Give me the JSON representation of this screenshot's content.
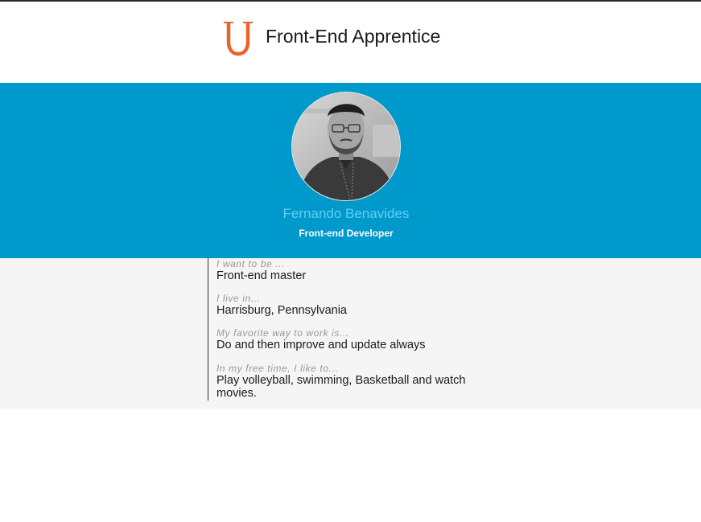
{
  "header": {
    "logo_icon": "udacity-u-logo-icon",
    "logo_color": "#e8642c",
    "title": "Front-End Apprentice"
  },
  "profile": {
    "avatar_icon": "profile-photo",
    "name": "Fernando Benavides",
    "role": "Front-end Developer",
    "banner_color": "#0099cc",
    "name_color": "#5fd0f5"
  },
  "details": [
    {
      "label": "I want to be ...",
      "value": "Front-end master"
    },
    {
      "label": "I live in...",
      "value": "Harrisburg, Pennsylvania"
    },
    {
      "label": "My favorite way to work is...",
      "value": "Do and then improve and update always"
    },
    {
      "label": "In my free time, I like to...",
      "value": "Play volleyball, swimming, Basketball and watch movies."
    }
  ]
}
